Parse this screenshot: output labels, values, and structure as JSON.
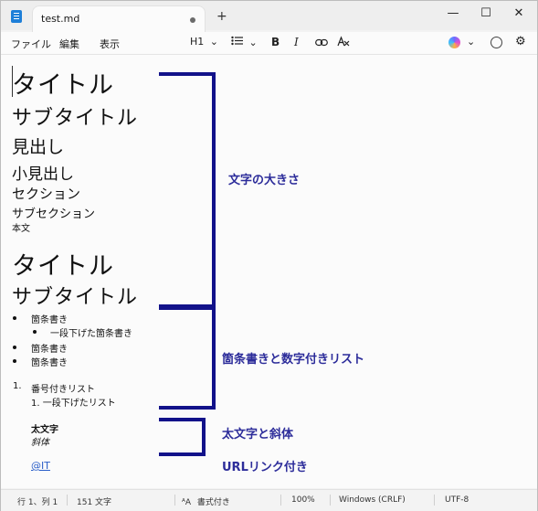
{
  "window": {
    "tab_title": "test.md",
    "new_tab": "+",
    "controls": {
      "minimize": "—",
      "maximize": "☐",
      "close": "✕"
    }
  },
  "menubar": {
    "file": "ファイル",
    "edit": "編集",
    "view": "表示",
    "heading": "H1",
    "chevron": "⌄"
  },
  "toolbar": {
    "bold": "B",
    "italic": "I"
  },
  "document": {
    "lines": {
      "title": "タイトル",
      "subtitle": "サブタイトル",
      "heading": "見出し",
      "subheading": "小見出し",
      "section": "セクション",
      "subsection": "サブセクション",
      "body": "本文",
      "title2": "タイトル",
      "subtitle2": "サブタイトル",
      "bullet1": "箇条書き",
      "bullet_nested": "一段下げた箇条書き",
      "bullet2": "箇条書き",
      "bullet3": "箇条書き",
      "numbered_marker": "1.",
      "numbered": "番号付きリスト",
      "numbered_nested": "1.  一段下げたリスト",
      "bold_text": "太文字",
      "italic_text": "斜体",
      "link": "@IT"
    }
  },
  "annotations": {
    "sizes": "文字の大きさ",
    "lists": "箇条書きと数字付きリスト",
    "emphasis": "太文字と斜体",
    "link": "URLリンク付き",
    "color": "#12128a"
  },
  "statusbar": {
    "position": "行 1、列 1",
    "chars": "151 文字",
    "format": "書式付き",
    "zoom": "100%",
    "eol": "Windows (CRLF)",
    "encoding": "UTF-8"
  }
}
